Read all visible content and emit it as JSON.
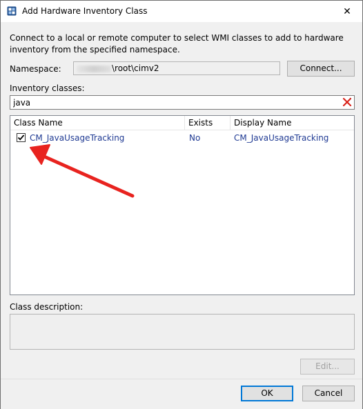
{
  "window": {
    "title": "Add Hardware Inventory Class",
    "close_glyph": "✕"
  },
  "intro_text": "Connect to a local or remote computer to select WMI classes to add to hardware inventory from the specified namespace.",
  "namespace": {
    "label": "Namespace:",
    "value": "\\root\\cimv2",
    "connect_button": "Connect..."
  },
  "inventory": {
    "label": "Inventory classes:",
    "search_value": "java"
  },
  "table": {
    "columns": [
      "Class Name",
      "Exists",
      "Display Name"
    ],
    "rows": [
      {
        "checked": true,
        "class_name": "CM_JavaUsageTracking",
        "exists": "No",
        "display_name": "CM_JavaUsageTracking"
      }
    ]
  },
  "description": {
    "label": "Class description:"
  },
  "buttons": {
    "edit": "Edit...",
    "ok": "OK",
    "cancel": "Cancel"
  },
  "colors": {
    "arrow": "#e8231f",
    "link_text": "#1f3a93",
    "default_button_border": "#0078d7"
  },
  "icons": {
    "title_icon": "hardware-inventory-icon",
    "clear_icon": "red-x-clear-icon",
    "check_icon": "checkmark-icon",
    "annotation": "red-arrow-icon"
  }
}
